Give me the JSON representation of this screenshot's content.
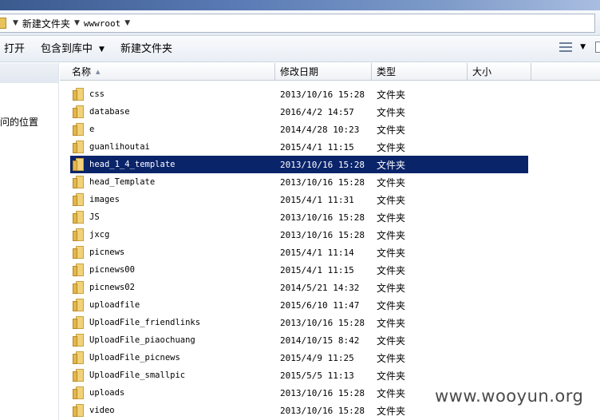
{
  "address": {
    "crumbs": [
      "新建文件夹",
      "wwwroot"
    ]
  },
  "toolbar": {
    "open_label": "打开",
    "include_label": "包含到库中",
    "new_folder_label": "新建文件夹"
  },
  "nav": {
    "partial_item": "问的位置"
  },
  "columns": {
    "name": "名称",
    "date": "修改日期",
    "type": "类型",
    "size": "大小"
  },
  "files": [
    {
      "name": "css",
      "date": "2013/10/16 15:28",
      "type": "文件夹"
    },
    {
      "name": "database",
      "date": "2016/4/2 14:57",
      "type": "文件夹"
    },
    {
      "name": "e",
      "date": "2014/4/28 10:23",
      "type": "文件夹"
    },
    {
      "name": "guanlihoutai",
      "date": "2015/4/1 11:15",
      "type": "文件夹"
    },
    {
      "name": "head_1_4_template",
      "date": "2013/10/16 15:28",
      "type": "文件夹",
      "selected": true
    },
    {
      "name": "head_Template",
      "date": "2013/10/16 15:28",
      "type": "文件夹"
    },
    {
      "name": "images",
      "date": "2015/4/1 11:31",
      "type": "文件夹"
    },
    {
      "name": "JS",
      "date": "2013/10/16 15:28",
      "type": "文件夹"
    },
    {
      "name": "jxcg",
      "date": "2013/10/16 15:28",
      "type": "文件夹"
    },
    {
      "name": "picnews",
      "date": "2015/4/1 11:14",
      "type": "文件夹"
    },
    {
      "name": "picnews00",
      "date": "2015/4/1 11:15",
      "type": "文件夹"
    },
    {
      "name": "picnews02",
      "date": "2014/5/21 14:32",
      "type": "文件夹"
    },
    {
      "name": "uploadfile",
      "date": "2015/6/10 11:47",
      "type": "文件夹"
    },
    {
      "name": "UploadFile_friendlinks",
      "date": "2013/10/16 15:28",
      "type": "文件夹"
    },
    {
      "name": "UploadFile_piaochuang",
      "date": "2014/10/15 8:42",
      "type": "文件夹"
    },
    {
      "name": "UploadFile_picnews",
      "date": "2015/4/9 11:25",
      "type": "文件夹"
    },
    {
      "name": "UploadFile_smallpic",
      "date": "2015/5/5 11:13",
      "type": "文件夹"
    },
    {
      "name": "uploads",
      "date": "2013/10/16 15:28",
      "type": "文件夹"
    },
    {
      "name": "video",
      "date": "2013/10/16 15:28",
      "type": "文件夹"
    }
  ],
  "watermark": "www.wooyun.org",
  "colors": {
    "selection": "#0a246a",
    "folder": "#f1d27a"
  }
}
